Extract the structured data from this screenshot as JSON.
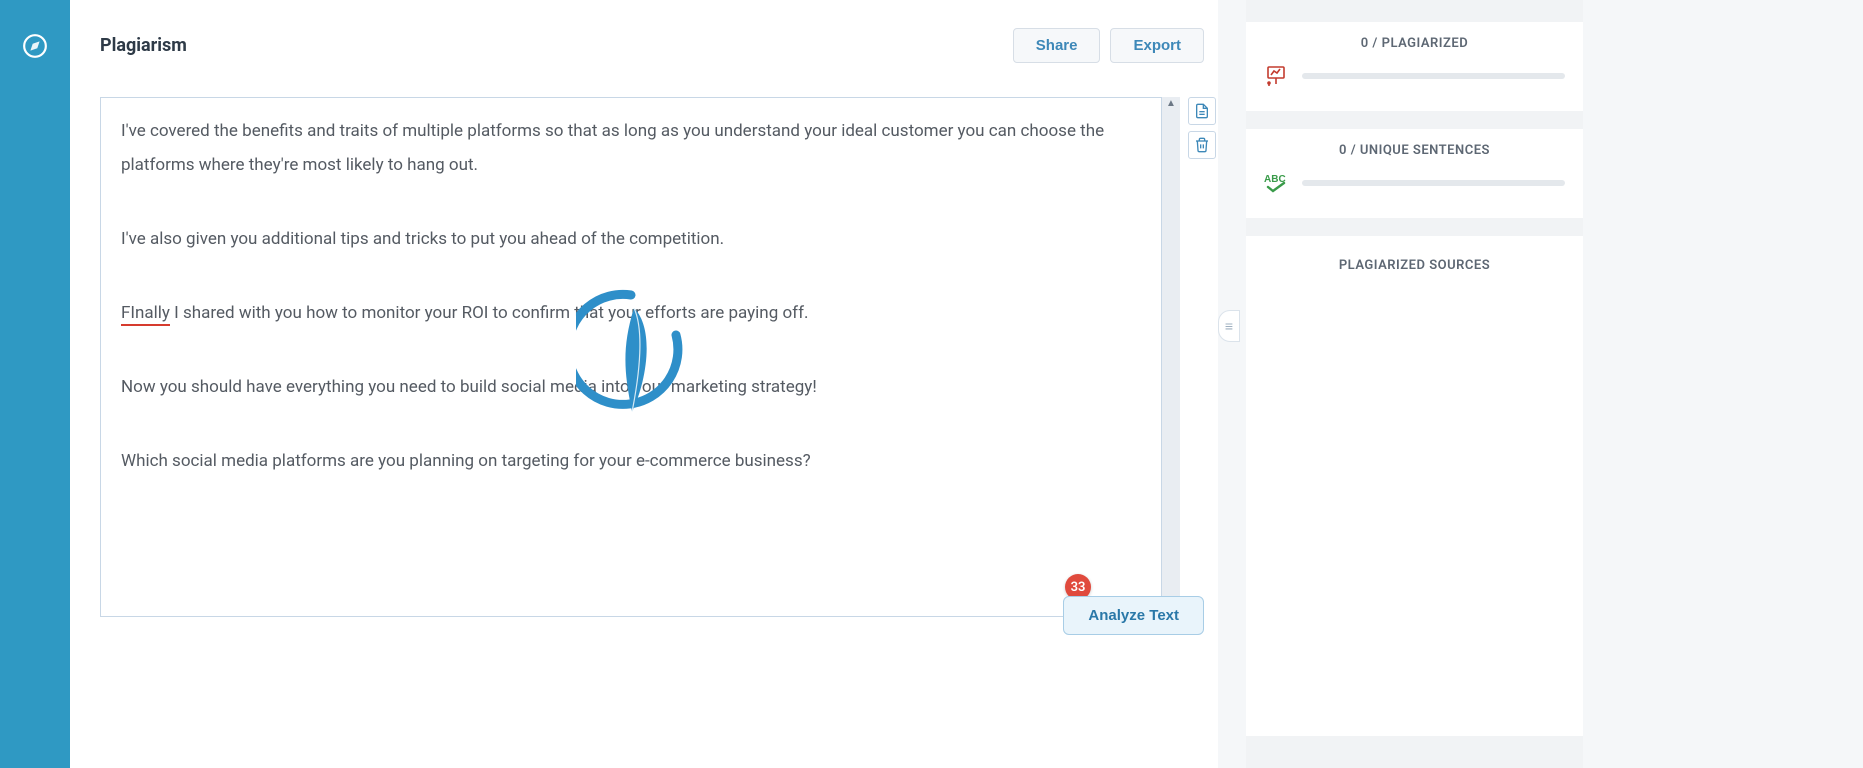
{
  "page": {
    "title": "Plagiarism"
  },
  "buttons": {
    "share": "Share",
    "export": "Export",
    "analyze": "Analyze Text"
  },
  "editor": {
    "paragraphs": [
      "I've covered the benefits and traits of multiple platforms so that as long as you understand your ideal customer you can choose the platforms where they're most likely to hang out.",
      "I've also given you additional tips and tricks to put you ahead of the competition.",
      "|SPELL|FInally|/SPELL| I shared with you how to monitor your ROI to confirm that your efforts are paying off.",
      "Now you should have everything you need to build social media into your marketing strategy!",
      "Which social media platforms are you planning on targeting for your e-commerce business?"
    ],
    "badge_count": "33"
  },
  "stats": {
    "plagiarized": "0 / PLAGIARIZED",
    "unique": "0 / UNIQUE SENTENCES",
    "sources_title": "PLAGIARIZED SOURCES"
  }
}
